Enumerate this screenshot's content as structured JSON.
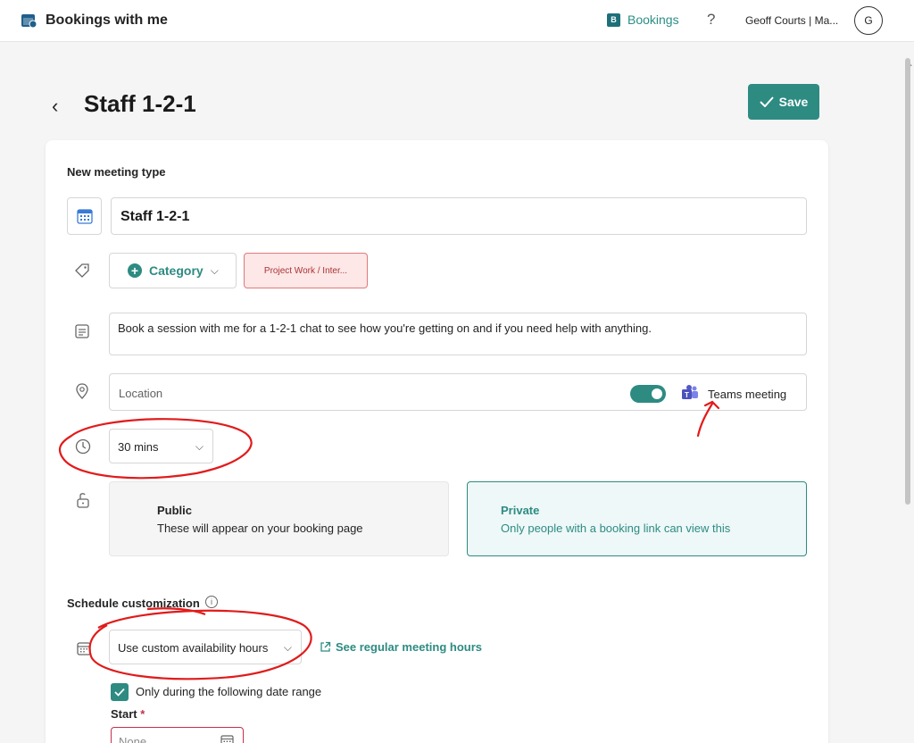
{
  "header": {
    "app_title": "Bookings with me",
    "bookings_link": "Bookings",
    "bookings_badge": "B",
    "help": "?",
    "user_name": "Geoff Courts | Ma...",
    "avatar_initial": "G"
  },
  "page": {
    "back": "‹",
    "title": "Staff 1-2-1",
    "save_label": "Save"
  },
  "form": {
    "section_heading": "New meeting type",
    "name_value": "Staff 1-2-1",
    "category_label": "Category",
    "category_tag": "Project Work / Inter...",
    "description": "Book a session with me for a 1-2-1 chat to see how you're getting on and if you need help with anything.",
    "location_placeholder": "Location",
    "teams_toggle_on": true,
    "teams_label": "Teams meeting",
    "duration": "30 mins",
    "visibility": {
      "public_title": "Public",
      "public_desc": "These will appear on your booking page",
      "private_title": "Private",
      "private_desc": "Only people with a booking link can view this",
      "selected": "Private"
    }
  },
  "schedule": {
    "heading": "Schedule customization",
    "info": "i",
    "availability": "Use custom availability hours",
    "see_hours": "See regular meeting hours",
    "date_range_checked": true,
    "date_range_label": "Only during the following date range",
    "start_label": "Start",
    "required_mark": "*",
    "start_placeholder": "None"
  },
  "colors": {
    "accent": "#2d8b82",
    "annotation": "#e11b1b",
    "tag_bg": "#fde7e7",
    "tag_border": "#e07a7a"
  }
}
